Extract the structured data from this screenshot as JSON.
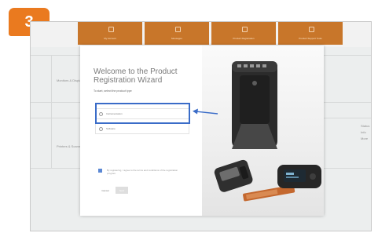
{
  "step_badge": "3",
  "toolbar": {
    "tiles": [
      {
        "label": "My Account"
      },
      {
        "label": "Messages"
      },
      {
        "label": "Product Registration"
      },
      {
        "label": "Product Support Tools"
      }
    ]
  },
  "background": {
    "row_labels": [
      "Monitors & Displays",
      "Printers & Scanners"
    ],
    "right_labels": [
      "Status",
      "Info",
      "More"
    ]
  },
  "wizard": {
    "close_label": "×",
    "title": "Welcome to the Product Registration Wizard",
    "subtitle": "To start, select the product type",
    "options": [
      {
        "label": "Instrumentation"
      },
      {
        "label": "Software"
      }
    ],
    "checkbox_text": "By registering, I agree to the terms and conditions of the registration program.",
    "cancel_label": "Cancel",
    "next_label": "Next",
    "footer": "•",
    "photo": {
      "device_colors": {
        "body": "#2b2b2b",
        "accent": "#c4682f",
        "screen": "#1e2a33"
      }
    }
  },
  "annotation": {
    "highlight_color": "#3a6cc8",
    "arrow_icon": "left-arrow-icon"
  },
  "colors": {
    "badge": "#ea7a1f",
    "toolbar_tile": "#c8762a"
  }
}
